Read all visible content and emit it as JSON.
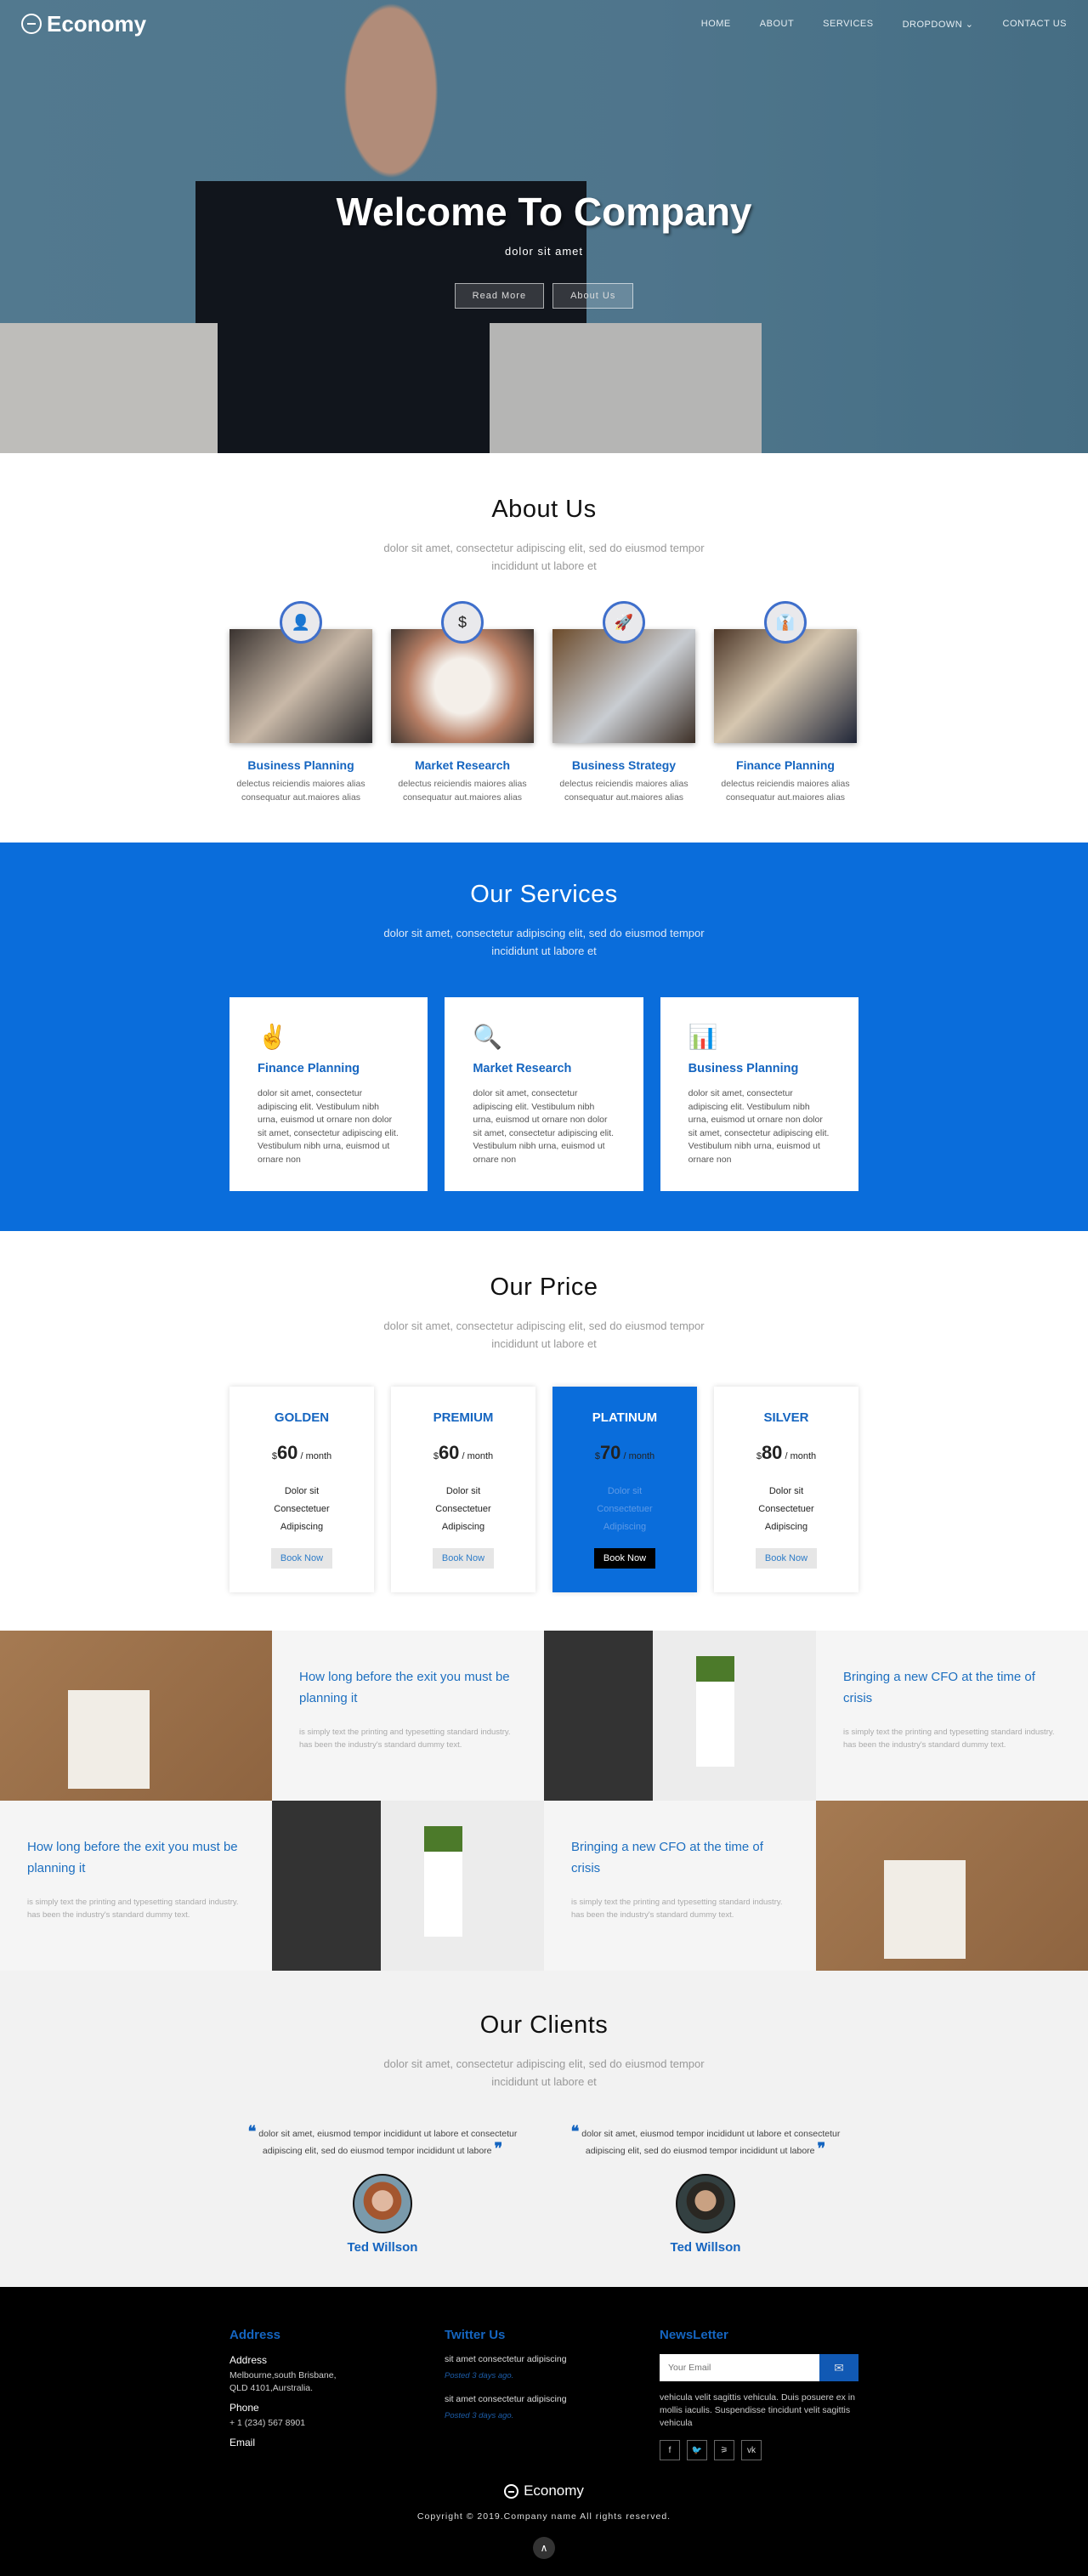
{
  "brand": "Economy",
  "nav": [
    "HOME",
    "ABOUT",
    "SERVICES",
    "DROPDOWN ⌄",
    "CONTACT US"
  ],
  "hero": {
    "title": "Welcome To Company",
    "subtitle": "dolor sit amet",
    "buttons": [
      "Read More",
      "About Us"
    ]
  },
  "section_sub": "dolor sit amet, consectetur adipiscing elit, sed do eiusmod tempor incididunt ut labore et",
  "about": {
    "title": "About Us",
    "cards": [
      {
        "title": "Business Planning",
        "icon": "👤",
        "desc": "delectus reiciendis maiores alias consequatur aut.maiores alias"
      },
      {
        "title": "Market Research",
        "icon": "$",
        "desc": "delectus reiciendis maiores alias consequatur aut.maiores alias"
      },
      {
        "title": "Business Strategy",
        "icon": "🚀",
        "desc": "delectus reiciendis maiores alias consequatur aut.maiores alias"
      },
      {
        "title": "Finance Planning",
        "icon": "👔",
        "desc": "delectus reiciendis maiores alias consequatur aut.maiores alias"
      }
    ]
  },
  "services": {
    "title": "Our Services",
    "cards": [
      {
        "title": "Finance Planning",
        "icon": "✌",
        "desc": "dolor sit amet, consectetur adipiscing elit. Vestibulum nibh urna, euismod ut ornare non dolor sit amet, consectetur adipiscing elit. Vestibulum nibh urna, euismod ut ornare non"
      },
      {
        "title": "Market Research",
        "icon": "🔍",
        "desc": "dolor sit amet, consectetur adipiscing elit. Vestibulum nibh urna, euismod ut ornare non dolor sit amet, consectetur adipiscing elit. Vestibulum nibh urna, euismod ut ornare non"
      },
      {
        "title": "Business Planning",
        "icon": "📊",
        "desc": "dolor sit amet, consectetur adipiscing elit. Vestibulum nibh urna, euismod ut ornare non dolor sit amet, consectetur adipiscing elit. Vestibulum nibh urna, euismod ut ornare non"
      }
    ]
  },
  "price": {
    "title": "Our Price",
    "currency": "$",
    "period": "/ month",
    "book": "Book Now",
    "plans": [
      {
        "name": "GOLDEN",
        "amount": "60",
        "features": [
          "Dolor sit",
          "Consectetuer",
          "Adipiscing"
        ]
      },
      {
        "name": "PREMIUM",
        "amount": "60",
        "features": [
          "Dolor sit",
          "Consectetuer",
          "Adipiscing"
        ]
      },
      {
        "name": "PLATINUM",
        "amount": "70",
        "features": [
          "Dolor sit",
          "Consectetuer",
          "Adipiscing"
        ]
      },
      {
        "name": "SILVER",
        "amount": "80",
        "features": [
          "Dolor sit",
          "Consectetuer",
          "Adipiscing"
        ]
      }
    ]
  },
  "blog": [
    {
      "title": "How long before the exit you must be planning it",
      "text": "is simply text the printing and typesetting standard industry. has been the industry's standard dummy text."
    },
    {
      "title": "Bringing a new CFO at the time of crisis",
      "text": "is simply text the printing and typesetting standard industry. has been the industry's standard dummy text."
    },
    {
      "title": "How long before the exit you must be planning it",
      "text": "is simply text the printing and typesetting standard industry. has been the industry's standard dummy text."
    },
    {
      "title": "Bringing a new CFO at the time of crisis",
      "text": "is simply text the printing and typesetting standard industry. has been the industry's standard dummy text."
    }
  ],
  "clients": {
    "title": "Our Clients",
    "items": [
      {
        "quote": "dolor sit amet, eiusmod tempor incididunt ut labore et consectetur adipiscing elit, sed do eiusmod tempor incididunt ut labore",
        "name": "Ted Willson"
      },
      {
        "quote": "dolor sit amet, eiusmod tempor incididunt ut labore et consectetur adipiscing elit, sed do eiusmod tempor incididunt ut labore",
        "name": "Ted Willson"
      }
    ]
  },
  "footer": {
    "address": {
      "heading": "Address",
      "address_label": "Address",
      "address_value": "Melbourne,south Brisbane, QLD 4101,Aurstralia.",
      "phone_label": "Phone",
      "phone_value": "+ 1 (234) 567 8901",
      "email_label": "Email"
    },
    "twitter": {
      "heading": "Twitter Us",
      "posts": [
        {
          "text": "sit amet consectetur adipiscing",
          "date": "Posted 3 days ago."
        },
        {
          "text": "sit amet consectetur adipiscing",
          "date": "Posted 3 days ago."
        }
      ]
    },
    "newsletter": {
      "heading": "NewsLetter",
      "placeholder": "Your Email",
      "text": "vehicula velit sagittis vehicula. Duis posuere ex in mollis iaculis. Suspendisse tincidunt velit sagittis vehicula",
      "social": [
        "f",
        "t",
        "rss",
        "vk"
      ]
    },
    "copyright": "Copyright © 2019.Company name All rights reserved."
  },
  "colors": {
    "accent": "#0a6ddb",
    "heading_blue": "#1565c0",
    "footer_bg": "#000000"
  }
}
